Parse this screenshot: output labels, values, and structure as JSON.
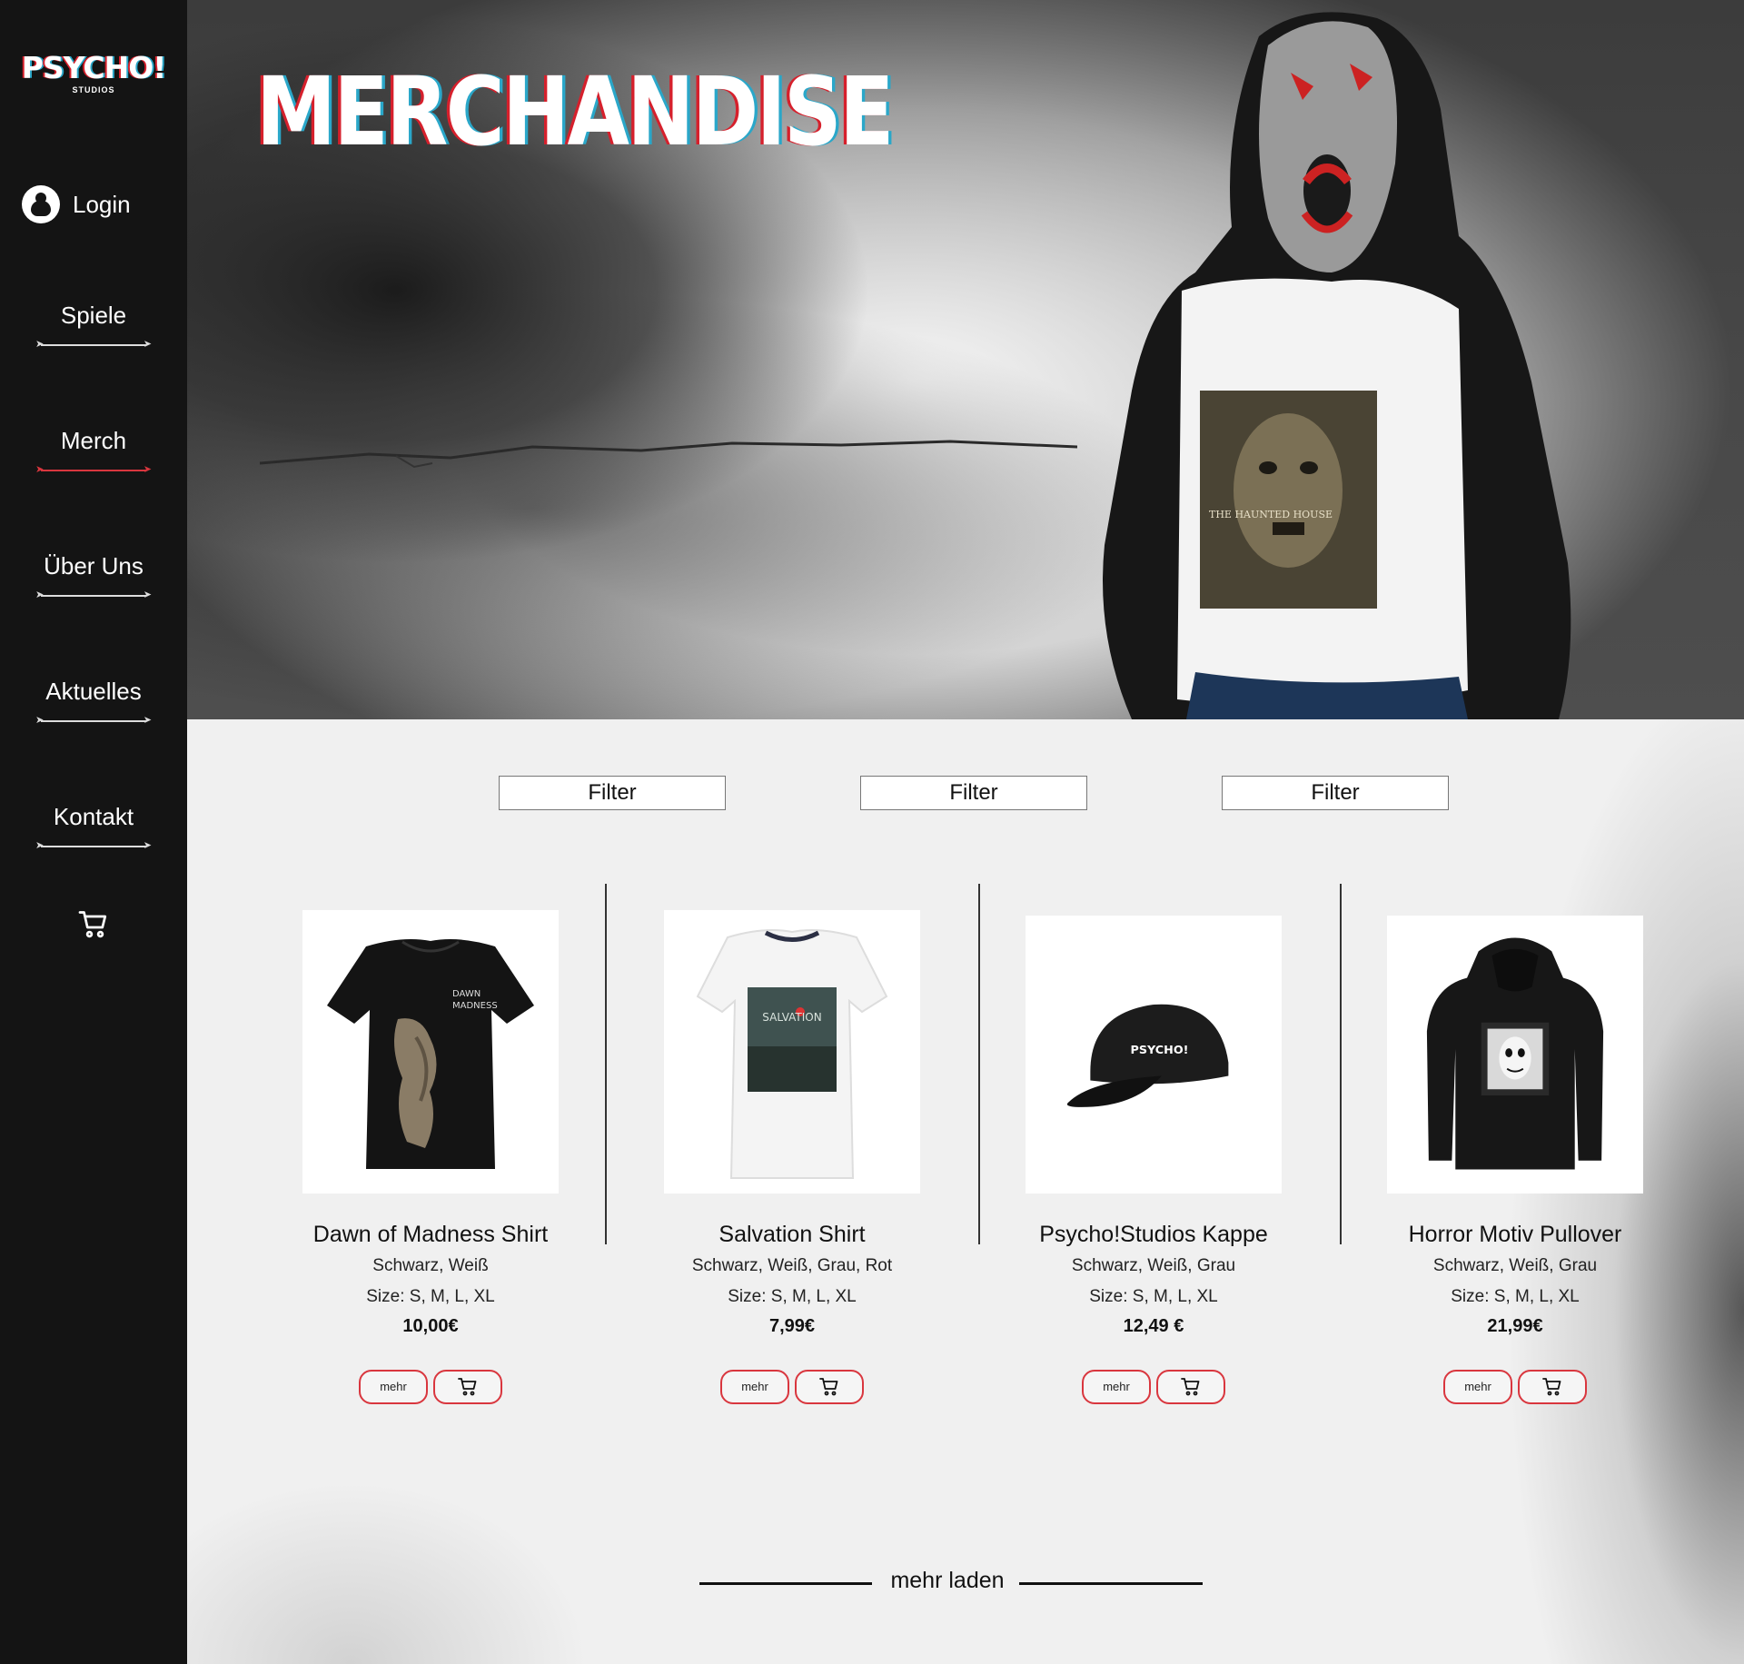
{
  "brand": {
    "name": "PSYCHO!",
    "sub": "STUDIOS"
  },
  "sidebar": {
    "login_label": "Login",
    "items": [
      {
        "label": "Spiele",
        "active": false
      },
      {
        "label": "Merch",
        "active": true
      },
      {
        "label": "Über Uns",
        "active": false
      },
      {
        "label": "Aktuelles",
        "active": false
      },
      {
        "label": "Kontakt",
        "active": false
      }
    ],
    "cart_icon": "cart-icon"
  },
  "hero": {
    "title": "MERCHANDISE",
    "shirt_print": "THE HAUNTED HOUSE"
  },
  "filters": [
    "Filter",
    "Filter",
    "Filter"
  ],
  "products": [
    {
      "name": "Dawn of Madness Shirt",
      "colors": "Schwarz, Weiß",
      "sizes": "Size: S, M, L, XL",
      "price": "10,00€",
      "more_label": "mehr",
      "image": "black-tshirt"
    },
    {
      "name": "Salvation Shirt",
      "colors": "Schwarz, Weiß, Grau, Rot",
      "sizes": "Size: S, M, L, XL",
      "price": "7,99€",
      "more_label": "mehr",
      "image": "white-tshirt",
      "print_text": "SALVATION"
    },
    {
      "name": "Psycho!Studios Kappe",
      "colors": "Schwarz, Weiß, Grau",
      "sizes": "Size: S, M, L, XL",
      "price": "12,49 €",
      "more_label": "mehr",
      "image": "black-cap",
      "print_text": "PSYCHO!"
    },
    {
      "name": "Horror Motiv Pullover",
      "colors": "Schwarz, Weiß, Grau",
      "sizes": "Size: S, M, L, XL",
      "price": "21,99€",
      "more_label": "mehr",
      "image": "black-hoodie"
    }
  ],
  "load_more": {
    "label": "mehr laden"
  },
  "colors": {
    "sidebar_bg": "#141414",
    "accent": "#d9363e",
    "page_bg": "#f0f0f0"
  }
}
